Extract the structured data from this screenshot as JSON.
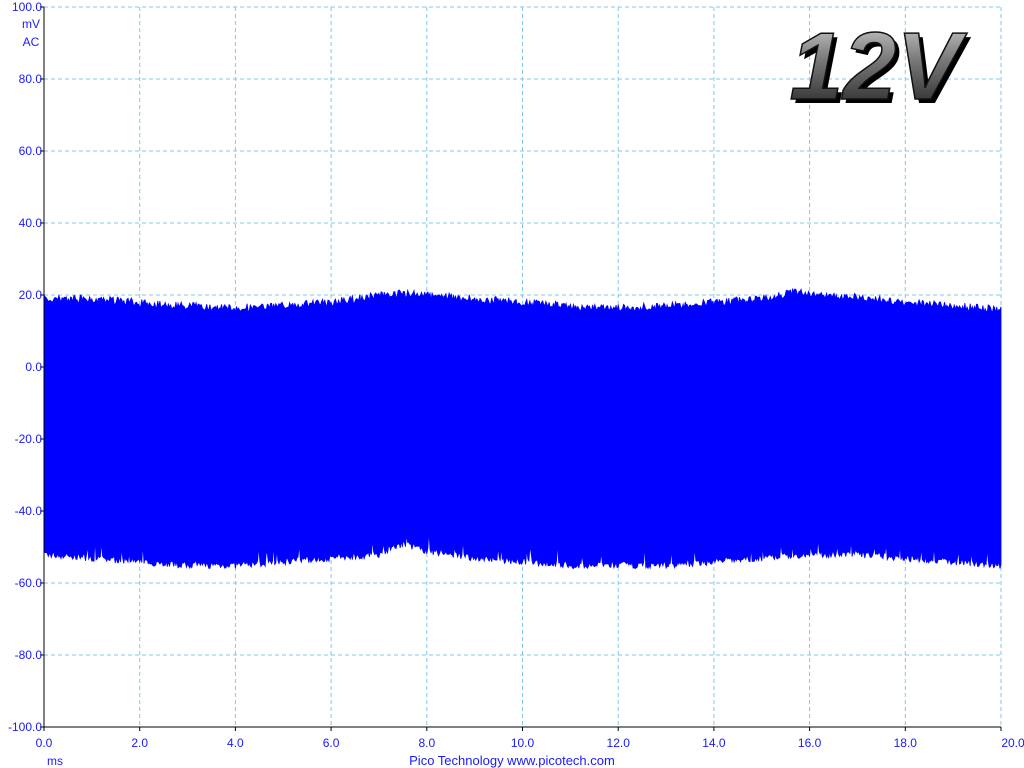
{
  "badge": {
    "text": "12V"
  },
  "footer": {
    "credit": "Pico Technology  www.picotech.com"
  },
  "colors": {
    "trace": "#0000ff",
    "axis_text": "#1a1aff",
    "axis_line": "#000000",
    "grid": "#7fc8e8",
    "footer_text": "#1a1aff",
    "background": "#ffffff"
  },
  "chart_data": {
    "type": "area",
    "title": "",
    "xlabel": "",
    "ylabel": "",
    "x_unit": "ms",
    "y_unit": "mV",
    "y_coupling": "AC",
    "xlim": [
      0,
      20
    ],
    "ylim": [
      -100,
      100
    ],
    "x_ticks": [
      "0.0",
      "2.0",
      "4.0",
      "6.0",
      "8.0",
      "10.0",
      "12.0",
      "14.0",
      "16.0",
      "18.0",
      "20.0"
    ],
    "y_ticks": [
      "100.0",
      "80.0",
      "60.0",
      "40.0",
      "20.0",
      "0.0",
      "-20.0",
      "-40.0",
      "-60.0",
      "-80.0",
      "-100.0"
    ],
    "grid": true,
    "grid_style": "dashed",
    "series": [
      {
        "upper_envelope": {
          "x": [
            0,
            1,
            2,
            3,
            4,
            5,
            6,
            7,
            7.5,
            8,
            9,
            10,
            11,
            12,
            13,
            14,
            15,
            15.7,
            16,
            17,
            18,
            19,
            20
          ],
          "y": [
            20,
            20,
            19,
            18,
            17.5,
            18,
            19,
            21,
            21.5,
            21,
            20,
            19,
            18,
            17.5,
            18,
            19,
            20,
            22,
            21,
            20.5,
            19,
            18,
            17
          ]
        },
        "lower_envelope": {
          "x": [
            0,
            1,
            2,
            3,
            4,
            5,
            6,
            7,
            7.5,
            8,
            9,
            10,
            11,
            12,
            13,
            14,
            15,
            16,
            17,
            18,
            19,
            20
          ],
          "y": [
            -53,
            -54,
            -55,
            -56,
            -56,
            -55,
            -54,
            -53,
            -50,
            -52,
            -54,
            -55,
            -56,
            -56,
            -56,
            -55,
            -54,
            -53,
            -53,
            -54,
            -55,
            -56
          ]
        }
      }
    ]
  }
}
